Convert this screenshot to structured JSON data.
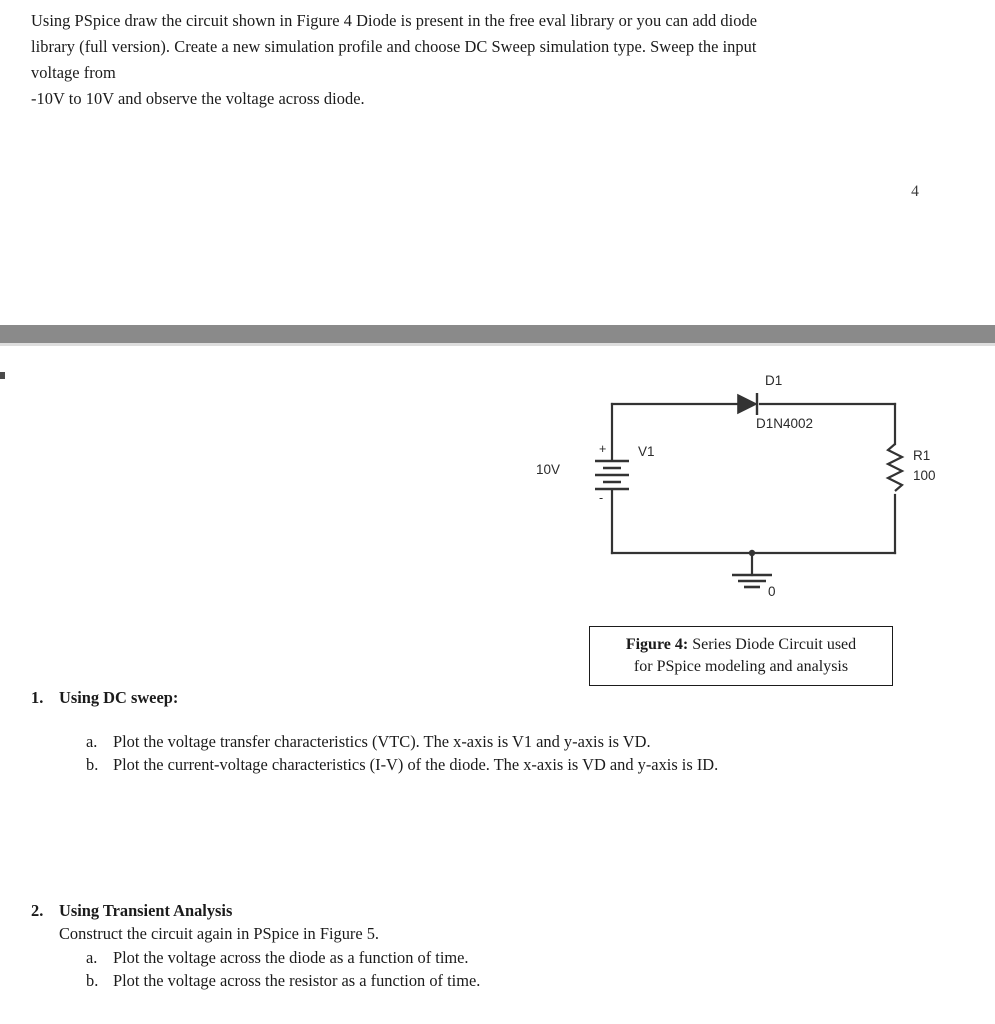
{
  "document": {
    "page_number": "4",
    "intro_paragraph": {
      "line1": "Using PSpice draw the circuit shown in Figure 4  Diode is present in the free eval library or you can add diode",
      "line2": "library  (full version).  Create a new simulation profile and choose DC Sweep simulation type. Sweep the input",
      "line3": "voltage from",
      "line4": "-10V to 10V and observe the voltage across diode."
    }
  },
  "figure": {
    "caption_prefix": "Figure 4:",
    "caption_line1_rest": " Series Diode Circuit used",
    "caption_line2": "for PSpice modeling and analysis",
    "circuit": {
      "source_value": "10V",
      "source_ref": "V1",
      "source_plus": "+",
      "source_minus": "-",
      "diode_ref": "D1",
      "diode_model": "D1N4002",
      "resistor_ref": "R1",
      "resistor_value": "100",
      "ground_label": "0"
    }
  },
  "tasks": [
    {
      "number": "1.",
      "title": "Using DC sweep:",
      "subtext": "",
      "items": [
        {
          "marker": "a.",
          "text": "Plot the voltage transfer characteristics (VTC). The x-axis is V1 and y-axis is VD."
        },
        {
          "marker": "b.",
          "text": "Plot the current-voltage characteristics (I-V) of the diode. The x-axis is VD and y-axis is ID."
        }
      ]
    },
    {
      "number": "2.",
      "title": "Using Transient Analysis",
      "subtext": "Construct the circuit again in PSpice in Figure 5.",
      "items": [
        {
          "marker": "a.",
          "text": "Plot the voltage across the diode as a function of time."
        },
        {
          "marker": "b.",
          "text": "Plot the voltage across the resistor as a function of time."
        }
      ]
    }
  ]
}
